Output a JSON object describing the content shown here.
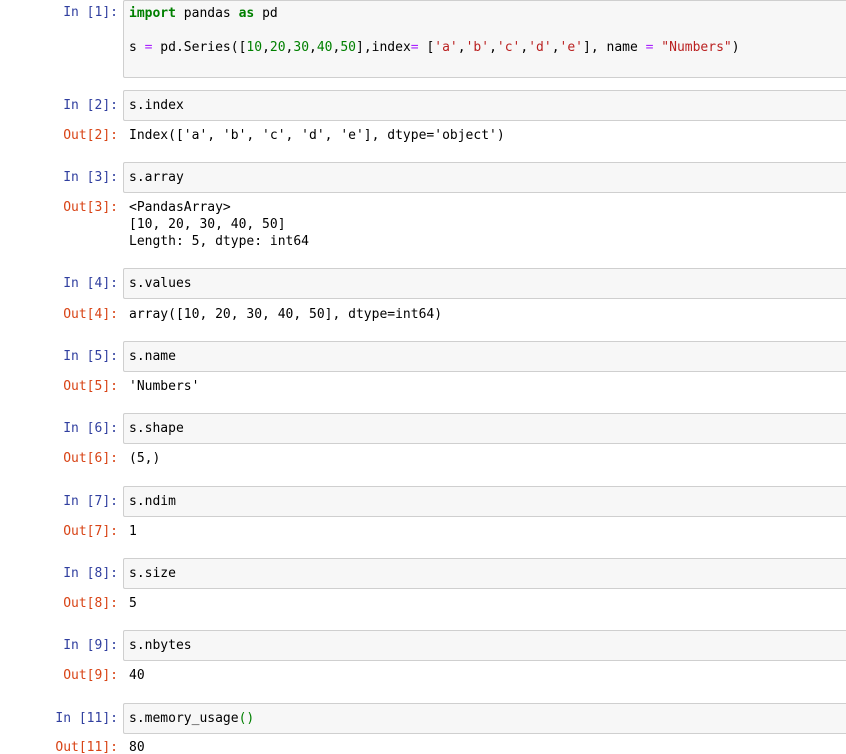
{
  "cells": [
    {
      "in_prompt": "In [1]:",
      "code_line1": {
        "kw1": "import",
        "t1": " pandas ",
        "kw2": "as",
        "t2": " pd"
      },
      "code_line2": {
        "a": "s ",
        "eq": "=",
        "b": " pd.Series([",
        "n1": "10",
        "c1": ",",
        "n2": "20",
        "c2": ",",
        "n3": "30",
        "c3": ",",
        "n4": "40",
        "c4": ",",
        "n5": "50",
        "c": "],index",
        "eq2": "=",
        "d": " [",
        "s1": "'a'",
        "k1": ",",
        "s2": "'b'",
        "k2": ",",
        "s3": "'c'",
        "k3": ",",
        "s4": "'d'",
        "k4": ",",
        "s5": "'e'",
        "e": "], name ",
        "eq3": "=",
        "f": " ",
        "s6": "\"Numbers\"",
        "g": ")"
      }
    },
    {
      "in_prompt": "In [2]:",
      "code": "s.index",
      "out_prompt": "Out[2]:",
      "output": "Index(['a', 'b', 'c', 'd', 'e'], dtype='object')"
    },
    {
      "in_prompt": "In [3]:",
      "code": "s.array",
      "out_prompt": "Out[3]:",
      "output": "<PandasArray>\n[10, 20, 30, 40, 50]\nLength: 5, dtype: int64"
    },
    {
      "in_prompt": "In [4]:",
      "code": "s.values",
      "out_prompt": "Out[4]:",
      "output": "array([10, 20, 30, 40, 50], dtype=int64)"
    },
    {
      "in_prompt": "In [5]:",
      "code": "s.name",
      "out_prompt": "Out[5]:",
      "output": "'Numbers'"
    },
    {
      "in_prompt": "In [6]:",
      "code": "s.shape",
      "out_prompt": "Out[6]:",
      "output": "(5,)"
    },
    {
      "in_prompt": "In [7]:",
      "code": "s.ndim",
      "out_prompt": "Out[7]:",
      "output": "1"
    },
    {
      "in_prompt": "In [8]:",
      "code": "s.size",
      "out_prompt": "Out[8]:",
      "output": "5"
    },
    {
      "in_prompt": "In [9]:",
      "code": "s.nbytes",
      "out_prompt": "Out[9]:",
      "output": "40"
    },
    {
      "in_prompt": "In [11]:",
      "code": "s.memory_usage",
      "code_paren": "()",
      "out_prompt": "Out[11]:",
      "output": "80"
    }
  ]
}
